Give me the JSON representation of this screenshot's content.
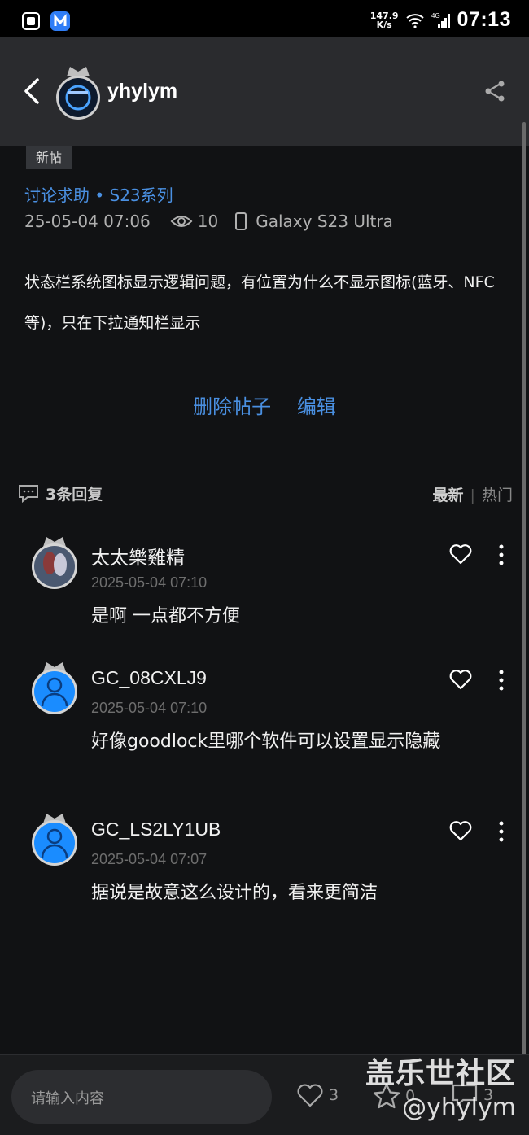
{
  "status_bar": {
    "speed_top": "147.9",
    "speed_bottom": "K/s",
    "time": "07:13"
  },
  "header": {
    "author": "yhylym"
  },
  "post": {
    "tag": "新帖",
    "category": "讨论求助 • S23系列",
    "date": "25-05-04 07:06",
    "views": "10",
    "device": "Galaxy S23 Ultra",
    "content": "状态栏系统图标显示逻辑问题，有位置为什么不显示图标(蓝牙、NFC等)，只在下拉通知栏显示",
    "actions": {
      "delete": "删除帖子",
      "edit": "编辑"
    }
  },
  "replies": {
    "count_label": "3条回复",
    "sort_latest": "最新",
    "sort_separator": "|",
    "sort_hot": "热门",
    "items": [
      {
        "name": "太太樂雞精",
        "time": "2025-05-04 07:10",
        "content": "是啊 一点都不方便"
      },
      {
        "name": "GC_08CXLJ9",
        "time": "2025-05-04 07:10",
        "content": "好像goodlock里哪个软件可以设置显示隐藏"
      },
      {
        "name": "GC_LS2LY1UB",
        "time": "2025-05-04 07:07",
        "content": "据说是故意这么设计的，看来更简洁"
      }
    ]
  },
  "bottom_bar": {
    "input_placeholder": "请输入内容",
    "likes": "3",
    "favorites": "0",
    "comments": "3"
  },
  "watermark": {
    "line1": "盖乐世社区",
    "line2": "@yhylym"
  },
  "colors": {
    "accent": "#4a90e2",
    "background": "#111214",
    "header_bg": "#2a2b2e"
  }
}
